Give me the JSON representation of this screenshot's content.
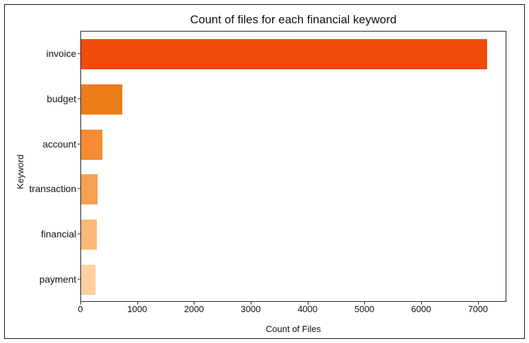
{
  "chart_data": {
    "type": "bar",
    "orientation": "horizontal",
    "title": "Count of files for each financial keyword",
    "xlabel": "Count of Files",
    "ylabel": "Keyword",
    "categories": [
      "invoice",
      "budget",
      "account",
      "transaction",
      "financial",
      "payment"
    ],
    "values": [
      7150,
      730,
      370,
      290,
      280,
      260
    ],
    "colors": [
      "#f04b0b",
      "#ed7c1a",
      "#f58b33",
      "#f6a054",
      "#fbb978",
      "#fdd1a1"
    ],
    "xlim": [
      0,
      7500
    ],
    "xticks": [
      0,
      1000,
      2000,
      3000,
      4000,
      5000,
      6000,
      7000
    ]
  }
}
